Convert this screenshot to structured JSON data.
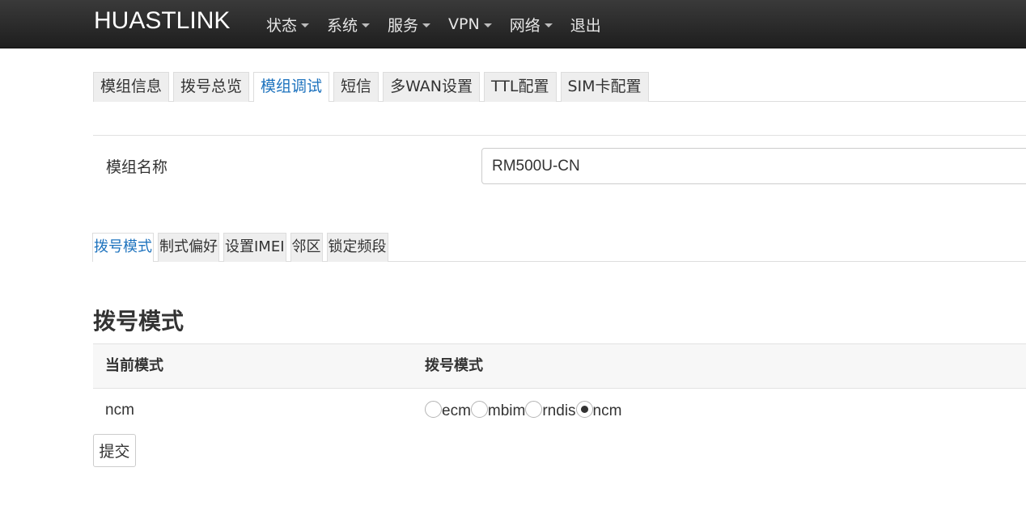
{
  "navbar": {
    "brand": "HUASTLINK",
    "menu": [
      {
        "label": "状态",
        "dropdown": true
      },
      {
        "label": "系统",
        "dropdown": true
      },
      {
        "label": "服务",
        "dropdown": true
      },
      {
        "label": "VPN",
        "dropdown": true
      },
      {
        "label": "网络",
        "dropdown": true
      },
      {
        "label": "退出",
        "dropdown": false
      }
    ]
  },
  "main_tabs": {
    "items": [
      "模组信息",
      "拨号总览",
      "模组调试",
      "短信",
      "多WAN设置",
      "TTL配置",
      "SIM卡配置"
    ],
    "active": "模组调试"
  },
  "module": {
    "label": "模组名称",
    "value": "RM500U-CN"
  },
  "sub_tabs": {
    "items": [
      "拨号模式",
      "制式偏好",
      "设置IMEI",
      "邻区",
      "锁定频段"
    ],
    "active": "拨号模式"
  },
  "dial_section": {
    "title": "拨号模式",
    "columns": [
      "当前模式",
      "拨号模式"
    ],
    "current_mode": "ncm",
    "options": [
      "ecm",
      "mbim",
      "rndis",
      "ncm"
    ],
    "selected": "ncm",
    "submit_label": "提交"
  },
  "colors": {
    "navbar_bg": "#2b2b2b",
    "active_tab_text": "#1e73be",
    "tab_bg": "#eeeeee"
  }
}
